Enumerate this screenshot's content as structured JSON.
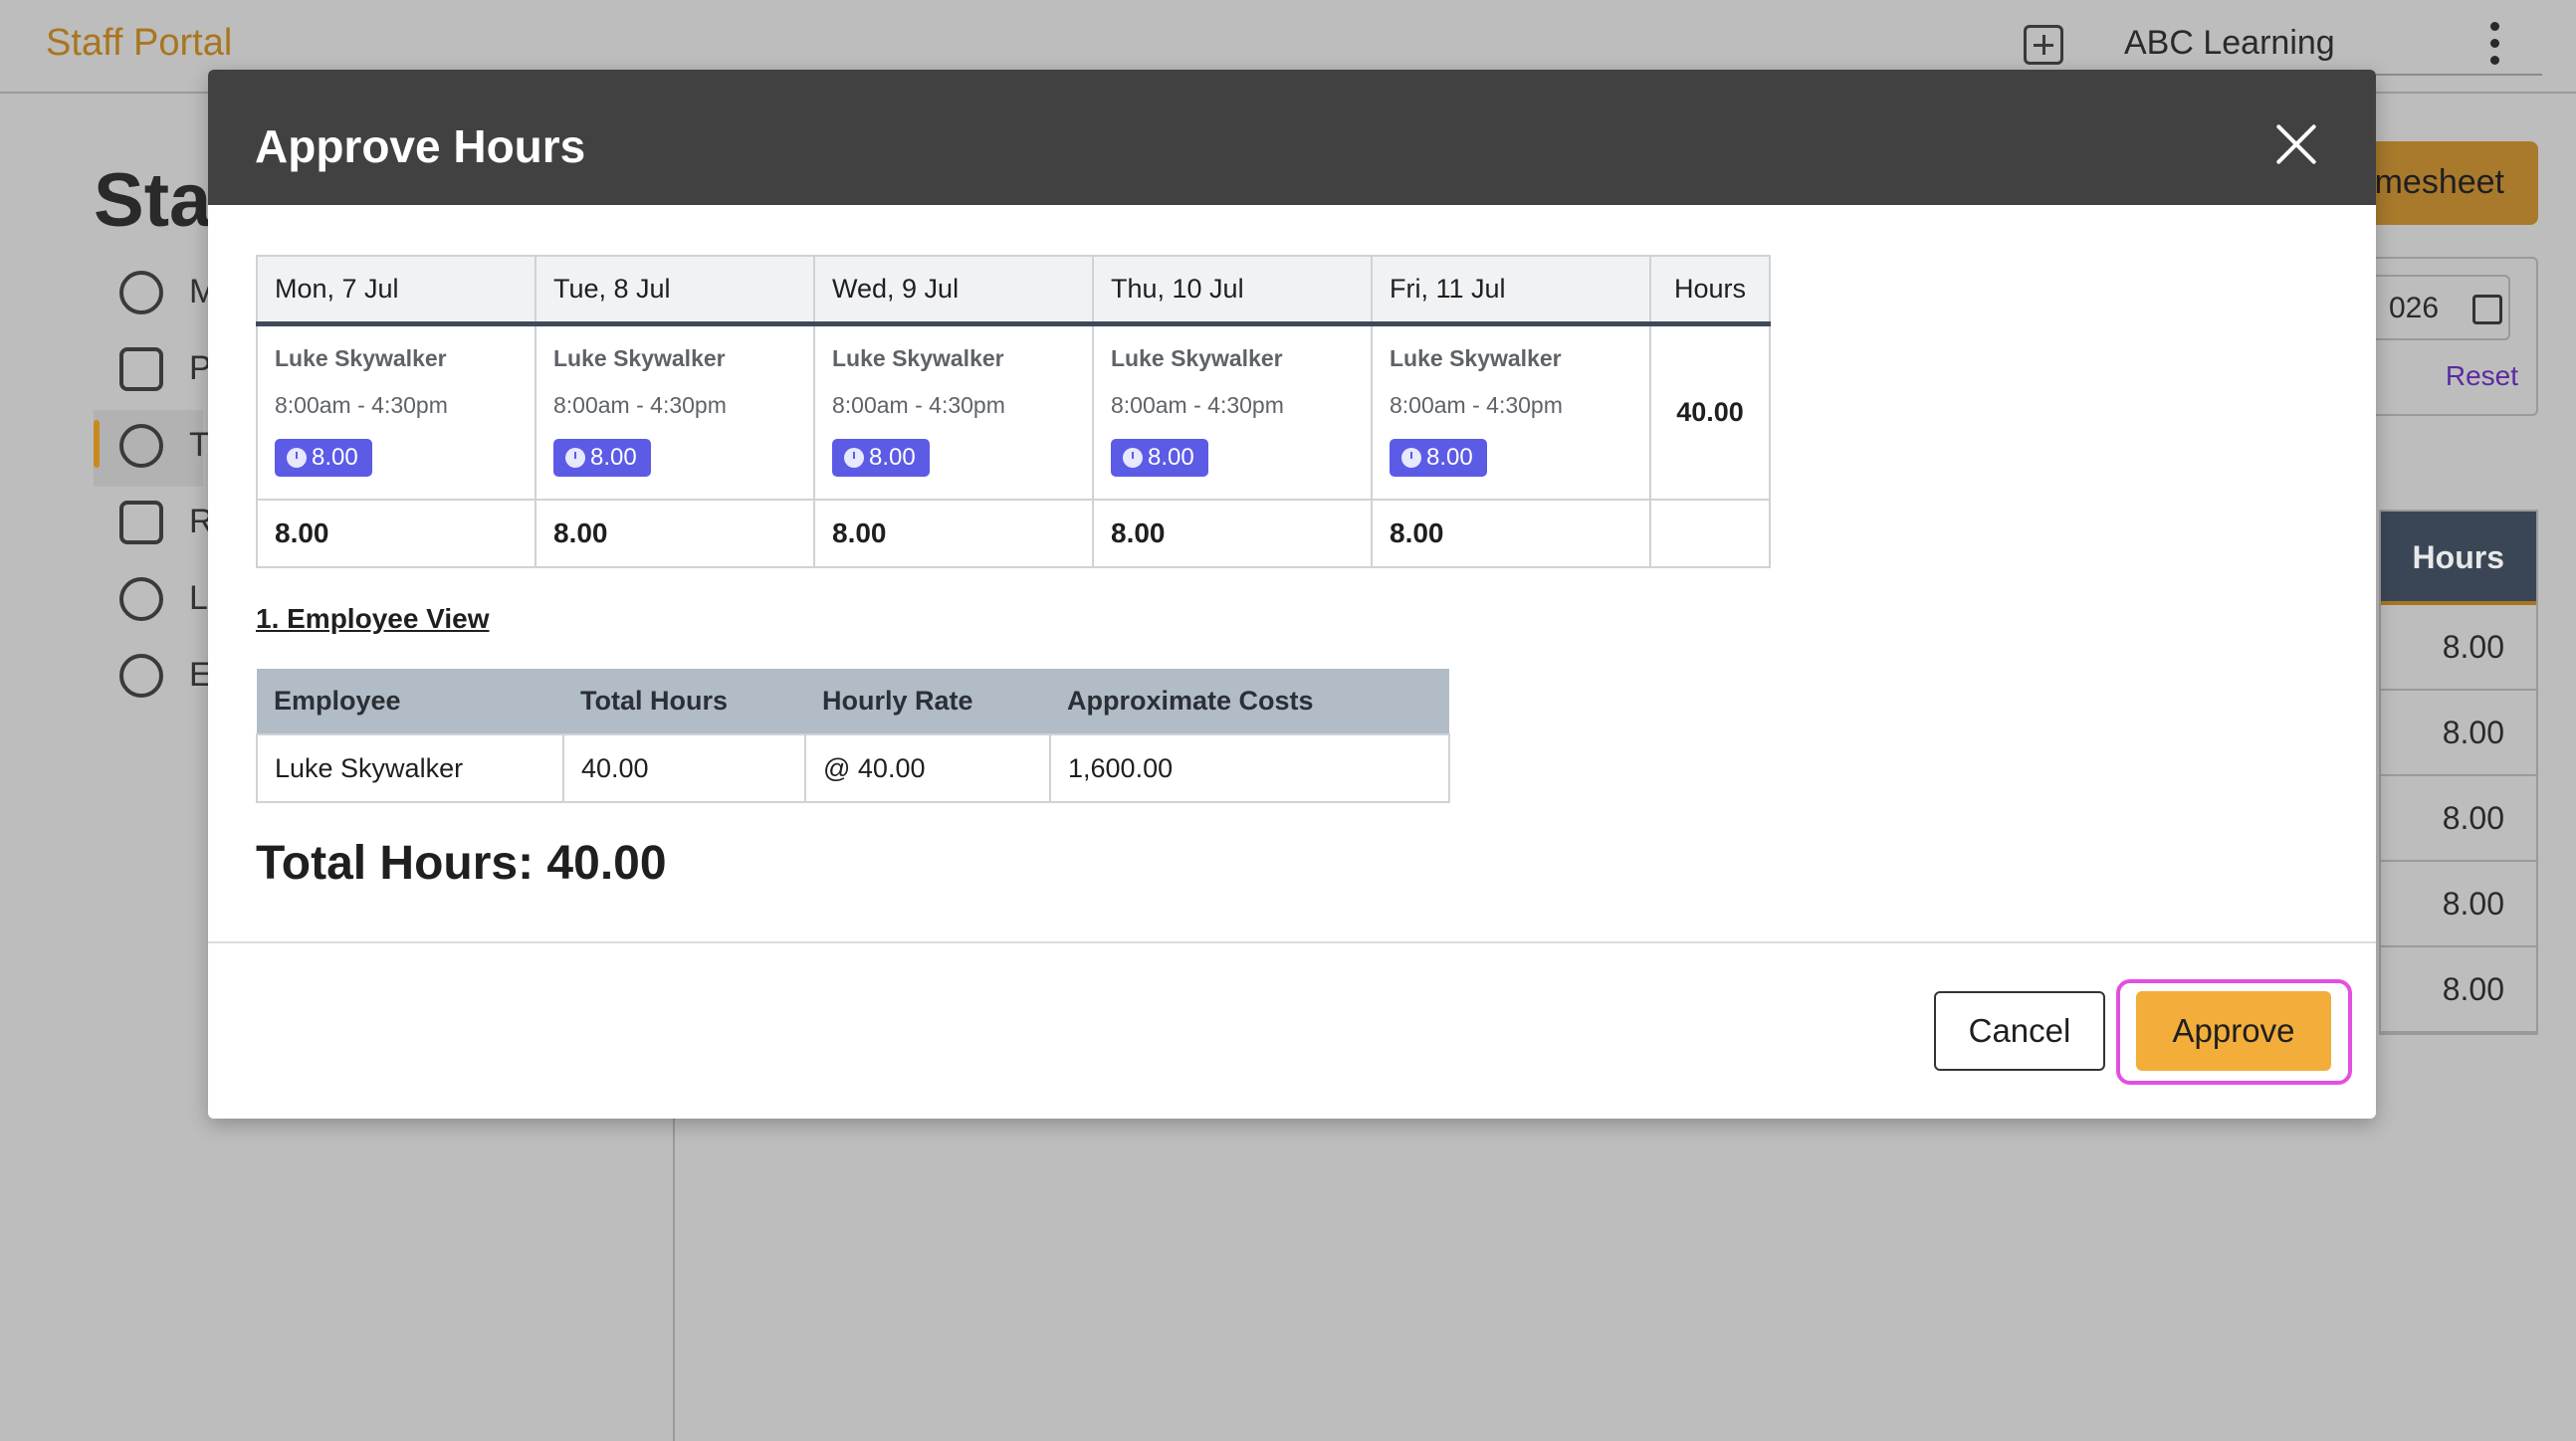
{
  "app": {
    "brand": "Staff Portal",
    "org_name": "ABC Learning",
    "page_heading": "Sta",
    "nav_letters": [
      "M",
      "P",
      "T",
      "R",
      "L",
      "E"
    ],
    "timesheet_button_partial": "mesheet",
    "date_partial": "026",
    "reset_label": "Reset",
    "hours_header": "Hours",
    "hours_rows": [
      "8.00",
      "8.00",
      "8.00",
      "8.00",
      "8.00"
    ]
  },
  "modal": {
    "title": "Approve Hours",
    "week": {
      "days": [
        "Mon, 7 Jul",
        "Tue, 8 Jul",
        "Wed, 9 Jul",
        "Thu, 10 Jul",
        "Fri, 11 Jul"
      ],
      "hours_header": "Hours",
      "shifts": [
        {
          "employee": "Luke Skywalker",
          "time": "8:00am - 4:30pm",
          "hours": "8.00"
        },
        {
          "employee": "Luke Skywalker",
          "time": "8:00am - 4:30pm",
          "hours": "8.00"
        },
        {
          "employee": "Luke Skywalker",
          "time": "8:00am - 4:30pm",
          "hours": "8.00"
        },
        {
          "employee": "Luke Skywalker",
          "time": "8:00am - 4:30pm",
          "hours": "8.00"
        },
        {
          "employee": "Luke Skywalker",
          "time": "8:00am - 4:30pm",
          "hours": "8.00"
        }
      ],
      "week_total": "40.00",
      "daily_totals": [
        "8.00",
        "8.00",
        "8.00",
        "8.00",
        "8.00"
      ]
    },
    "section_link": "1. Employee View",
    "employee_table": {
      "headers": [
        "Employee",
        "Total Hours",
        "Hourly Rate",
        "Approximate Costs"
      ],
      "rows": [
        [
          "Luke Skywalker",
          "40.00",
          "@ 40.00",
          "1,600.00"
        ]
      ]
    },
    "total_hours": "Total Hours: 40.00",
    "cancel_label": "Cancel",
    "approve_label": "Approve"
  },
  "colors": {
    "accent": "#f2ad3b",
    "header_bg": "#414141",
    "chip": "#5b5be6",
    "highlight": "#e34fe0"
  }
}
